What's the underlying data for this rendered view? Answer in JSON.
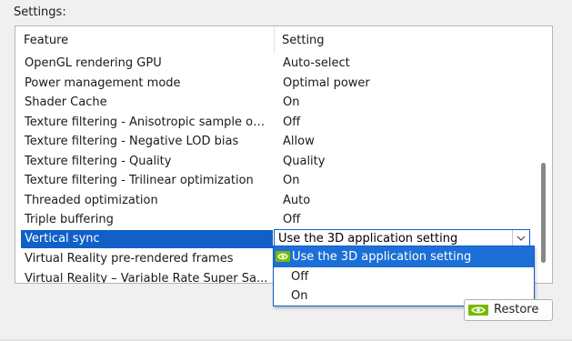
{
  "panel": {
    "title": "Settings:"
  },
  "table": {
    "columns": {
      "feature": "Feature",
      "setting": "Setting"
    },
    "rows": [
      {
        "feature": "OpenGL rendering GPU",
        "setting": "Auto-select"
      },
      {
        "feature": "Power management mode",
        "setting": "Optimal power"
      },
      {
        "feature": "Shader Cache",
        "setting": "On"
      },
      {
        "feature": "Texture filtering - Anisotropic sample opti...",
        "setting": "Off"
      },
      {
        "feature": "Texture filtering - Negative LOD bias",
        "setting": "Allow"
      },
      {
        "feature": "Texture filtering - Quality",
        "setting": "Quality"
      },
      {
        "feature": "Texture filtering - Trilinear optimization",
        "setting": "On"
      },
      {
        "feature": "Threaded optimization",
        "setting": "Auto"
      },
      {
        "feature": "Triple buffering",
        "setting": "Off"
      },
      {
        "feature": "Vertical sync",
        "setting": "Use the 3D application setting"
      },
      {
        "feature": "Virtual Reality pre-rendered frames",
        "setting": ""
      },
      {
        "feature": "Virtual Reality – Variable Rate Super Sa...",
        "setting": ""
      }
    ]
  },
  "dropdown": {
    "selected": "Use the 3D application setting",
    "options": [
      {
        "label": "Use the 3D application setting",
        "icon": "nvidia-icon"
      },
      {
        "label": "Off"
      },
      {
        "label": "On"
      }
    ]
  },
  "restore_button": {
    "label": "Restore",
    "icon": "nvidia-icon"
  },
  "colors": {
    "selection": "#1060c8",
    "highlight": "#1c6fd6",
    "nvidia_green": "#76b900"
  }
}
